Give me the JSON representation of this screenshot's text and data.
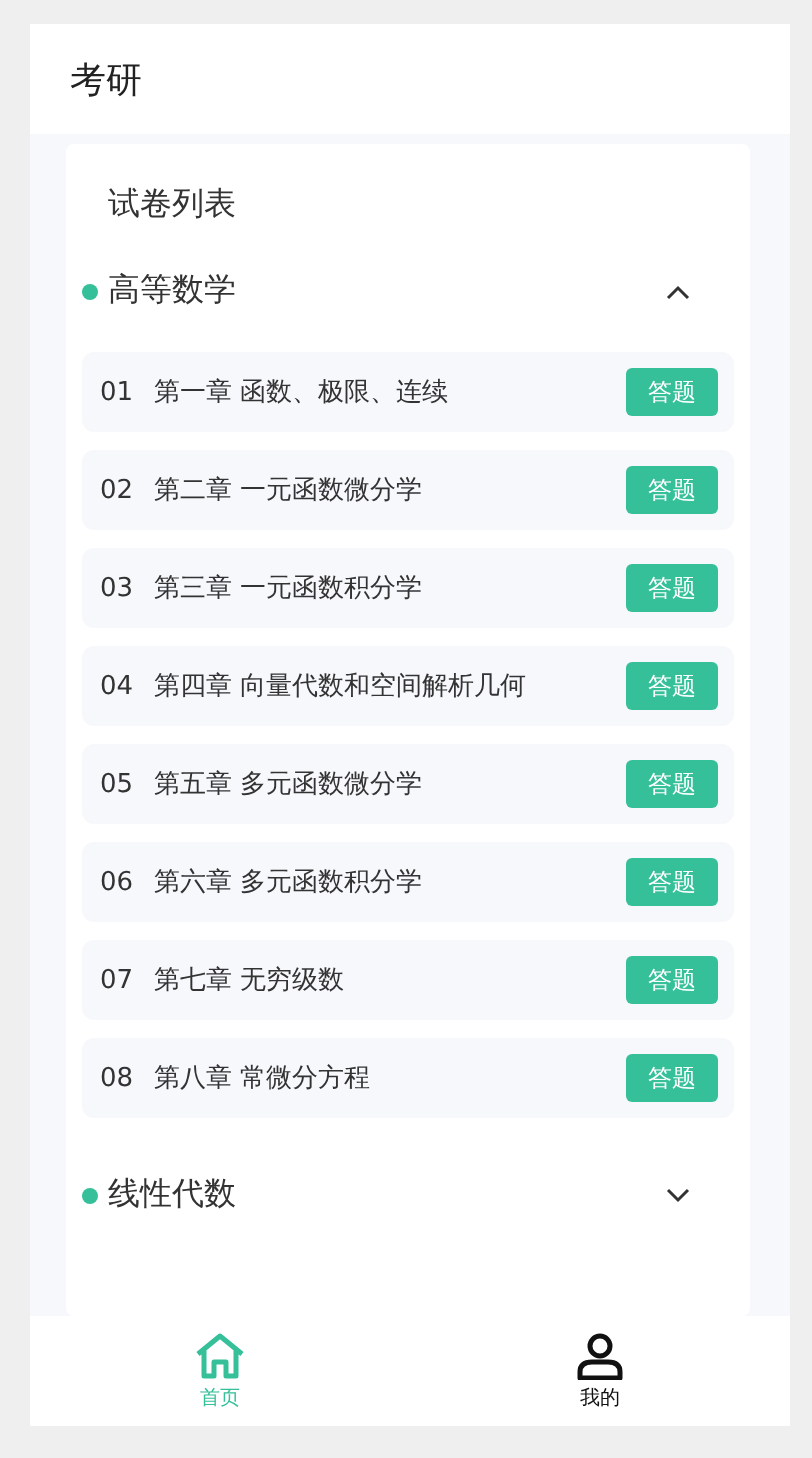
{
  "header": {
    "title": "考研"
  },
  "card": {
    "title": "试卷列表",
    "sections": [
      {
        "name": "高等数学",
        "color": "#35c09a",
        "expanded": true,
        "papers": [
          {
            "number": "01",
            "title": "第一章 函数、极限、连续",
            "action": "答题"
          },
          {
            "number": "02",
            "title": "第二章 一元函数微分学",
            "action": "答题"
          },
          {
            "number": "03",
            "title": "第三章 一元函数积分学",
            "action": "答题"
          },
          {
            "number": "04",
            "title": "第四章 向量代数和空间解析几何",
            "action": "答题"
          },
          {
            "number": "05",
            "title": "第五章 多元函数微分学",
            "action": "答题"
          },
          {
            "number": "06",
            "title": "第六章 多元函数积分学",
            "action": "答题"
          },
          {
            "number": "07",
            "title": "第七章 无穷级数",
            "action": "答题"
          },
          {
            "number": "08",
            "title": "第八章 常微分方程",
            "action": "答题"
          }
        ]
      },
      {
        "name": "线性代数",
        "color": "#35c09a",
        "expanded": false
      }
    ]
  },
  "tab_bar": [
    {
      "label": "首页",
      "kind": "home",
      "selected": true
    },
    {
      "label": "我的",
      "kind": "profile",
      "selected": false
    }
  ]
}
